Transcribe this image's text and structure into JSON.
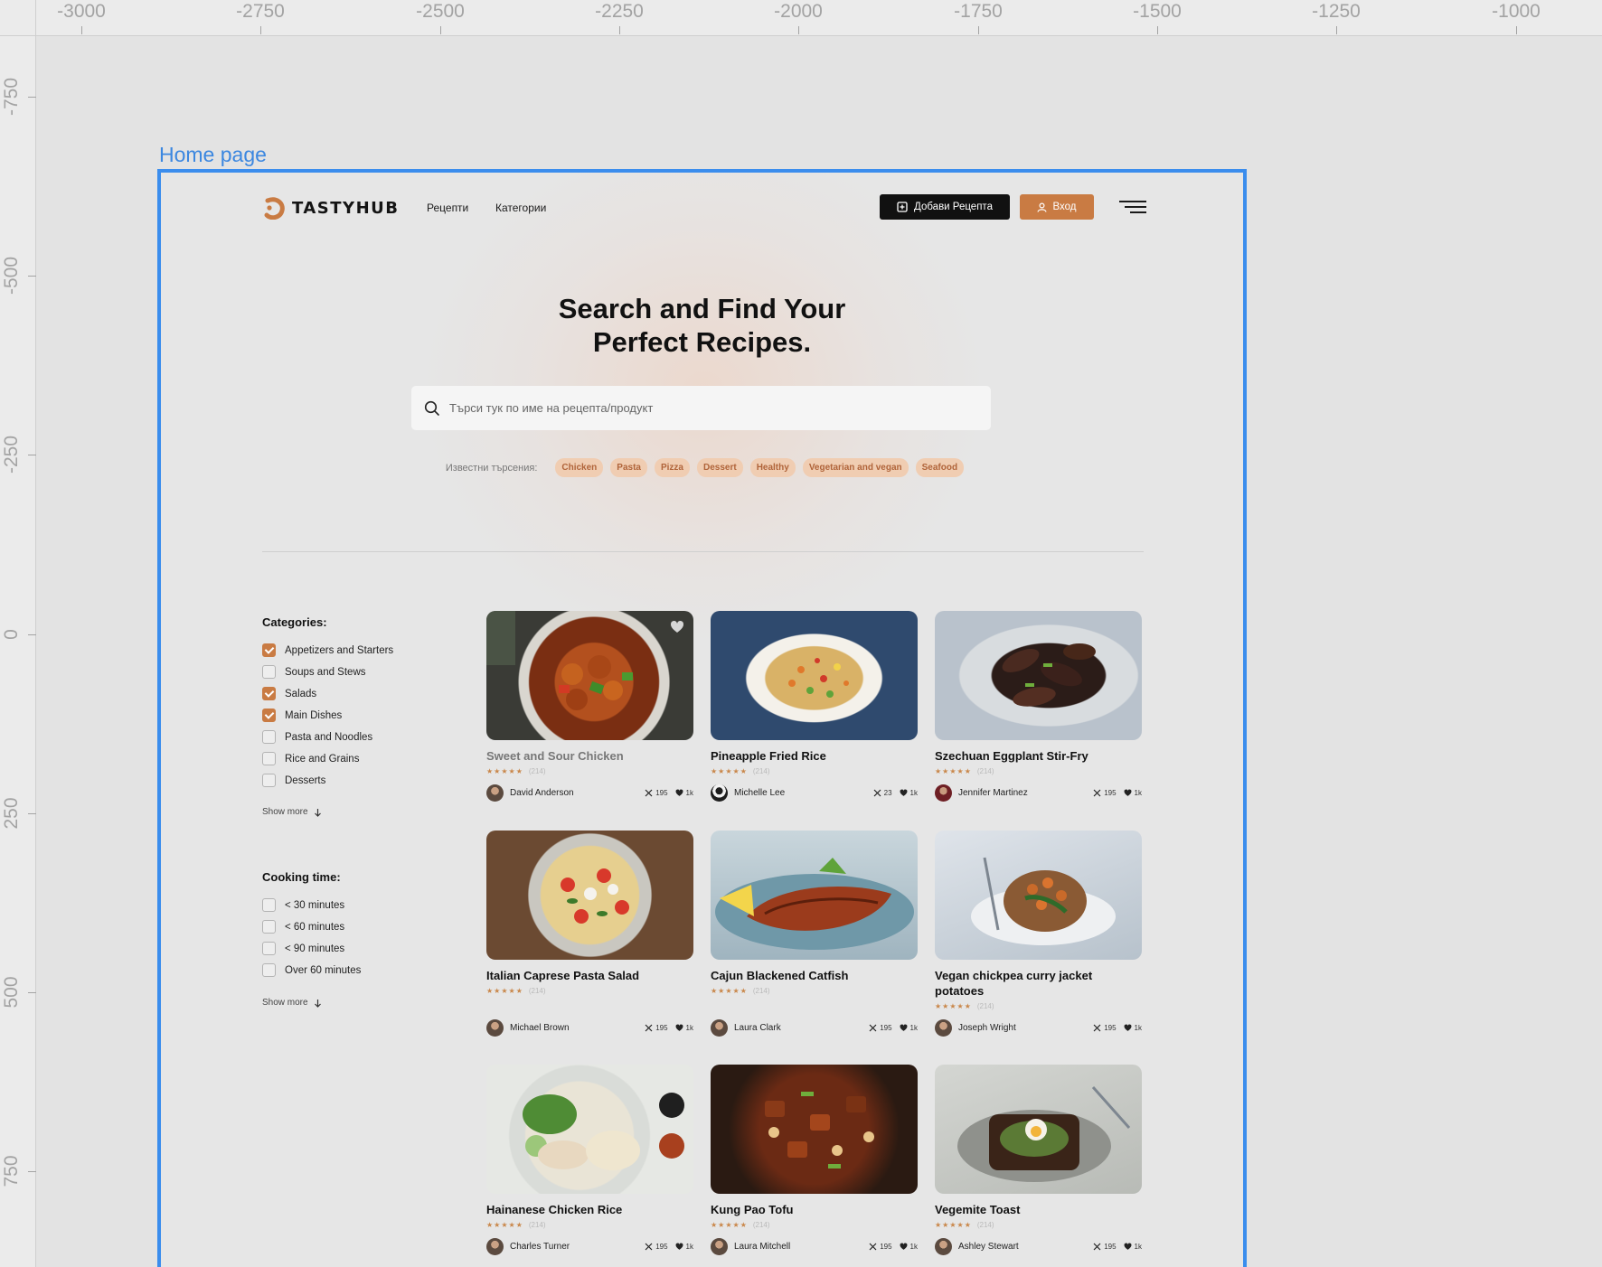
{
  "canvas": {
    "ruler_top": [
      "-3000",
      "-2750",
      "-2500",
      "-2250",
      "-2000",
      "-1750",
      "-1500",
      "-1250",
      "-1000"
    ],
    "ruler_left": [
      "-750",
      "-500",
      "-250",
      "0",
      "250",
      "500",
      "750"
    ],
    "frame_label": "Home page",
    "frame_color": "#3b8ded"
  },
  "header": {
    "logo_text": "TASTYHUB",
    "nav_recipes": "Рецепти",
    "nav_categories": "Категории",
    "add_recipe_label": "Добави Рецепта",
    "login_label": "Вход",
    "accent_color": "#c97b43"
  },
  "hero": {
    "title_line1": "Search and Find Your",
    "title_line2": "Perfect Recipes.",
    "search_placeholder": "Търси тук по име на рецепта/продукт",
    "popular_label": "Известни търсения:",
    "popular_tags": [
      "Chicken",
      "Pasta",
      "Pizza",
      "Dessert",
      "Healthy",
      "Vegetarian and vegan",
      "Seafood"
    ]
  },
  "filters": {
    "categories_title": "Categories:",
    "categories": [
      {
        "label": "Appetizers and Starters",
        "checked": true
      },
      {
        "label": "Soups and Stews",
        "checked": false
      },
      {
        "label": "Salads",
        "checked": true
      },
      {
        "label": "Main Dishes",
        "checked": true
      },
      {
        "label": "Pasta and Noodles",
        "checked": false
      },
      {
        "label": "Rice and Grains",
        "checked": false
      },
      {
        "label": "Desserts",
        "checked": false
      }
    ],
    "show_more": "Show more",
    "cooking_title": "Cooking time:",
    "cooking": [
      {
        "label": "< 30 minutes",
        "checked": false
      },
      {
        "label": "< 60 minutes",
        "checked": false
      },
      {
        "label": "< 90 minutes",
        "checked": false
      },
      {
        "label": "Over 60 minutes",
        "checked": false
      }
    ]
  },
  "recipes": [
    {
      "title": "Sweet and Sour Chicken",
      "rating_count": "(214)",
      "author": "David Anderson",
      "cooks": "195",
      "likes": "1k",
      "image": "sweet-sour-chicken-image"
    },
    {
      "title": "Pineapple Fried Rice",
      "rating_count": "(214)",
      "author": "Michelle Lee",
      "cooks": "23",
      "likes": "1k",
      "image": "fried-rice-image"
    },
    {
      "title": "Szechuan Eggplant Stir-Fry",
      "rating_count": "(214)",
      "author": "Jennifer Martinez",
      "cooks": "195",
      "likes": "1k",
      "image": "eggplant-image"
    },
    {
      "title": "Italian Caprese Pasta Salad",
      "rating_count": "(214)",
      "author": "Michael Brown",
      "cooks": "195",
      "likes": "1k",
      "image": "pasta-salad-image"
    },
    {
      "title": "Cajun Blackened Catfish",
      "rating_count": "(214)",
      "author": "Laura Clark",
      "cooks": "195",
      "likes": "1k",
      "image": "catfish-image"
    },
    {
      "title": "Vegan chickpea curry jacket potatoes",
      "rating_count": "(214)",
      "author": "Joseph Wright",
      "cooks": "195",
      "likes": "1k",
      "image": "jacket-potato-image"
    },
    {
      "title": "Hainanese Chicken Rice",
      "rating_count": "(214)",
      "author": "Charles Turner",
      "cooks": "195",
      "likes": "1k",
      "image": "chicken-rice-image"
    },
    {
      "title": "Kung Pao Tofu",
      "rating_count": "(214)",
      "author": "Laura Mitchell",
      "cooks": "195",
      "likes": "1k",
      "image": "kung-pao-image"
    },
    {
      "title": "Vegemite Toast",
      "rating_count": "(214)",
      "author": "Ashley Stewart",
      "cooks": "195",
      "likes": "1k",
      "image": "toast-image"
    }
  ]
}
